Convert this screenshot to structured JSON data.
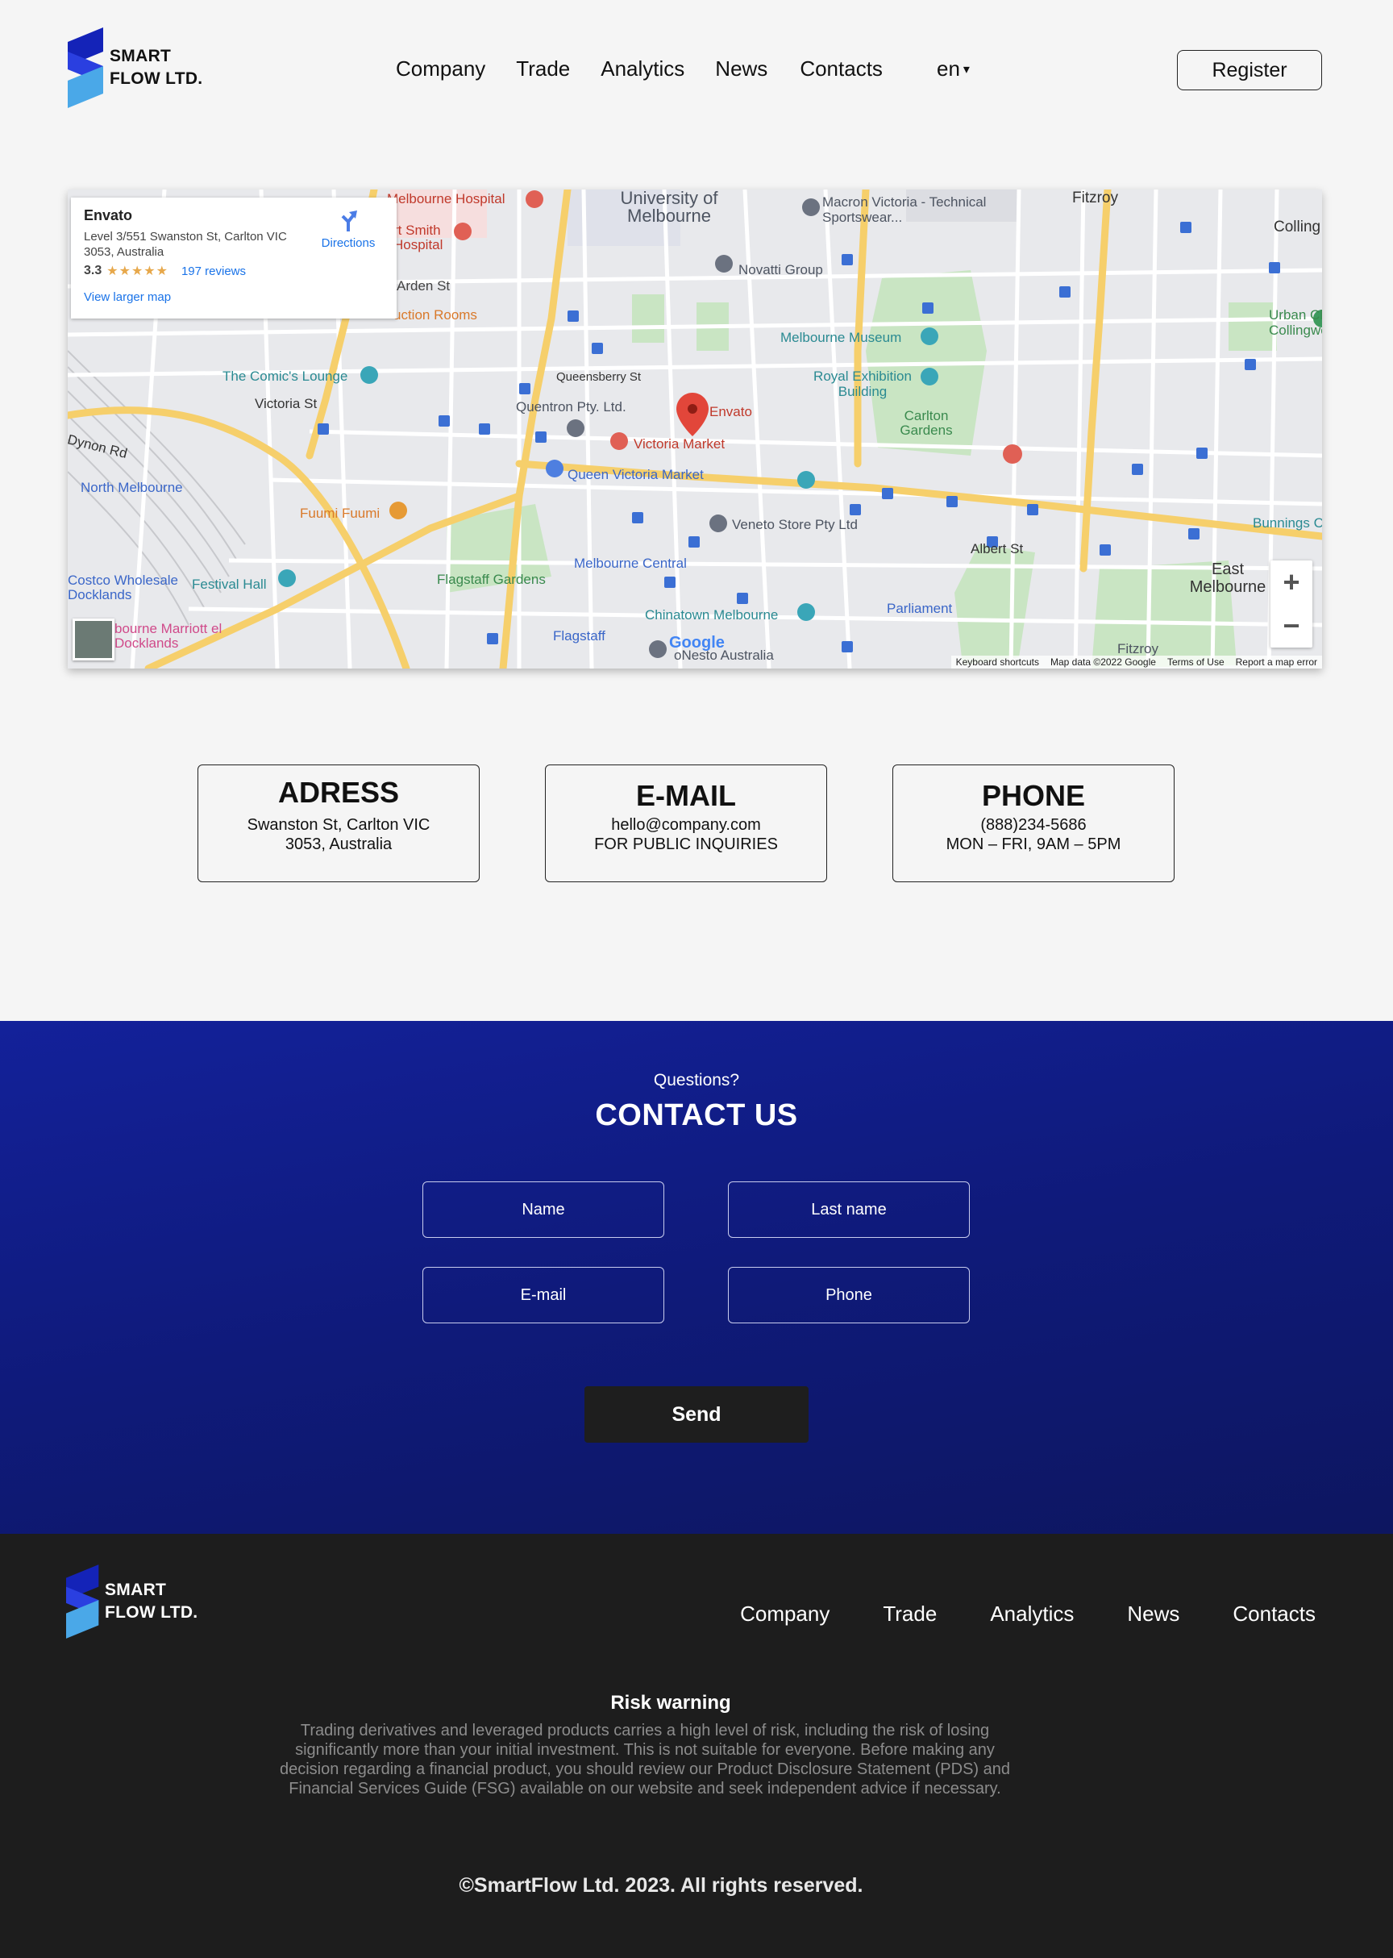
{
  "brand": {
    "line1": "SMART",
    "line2": "FLOW LTD.",
    "colors": {
      "dark": "#1423b8",
      "mid": "#2a3fe0",
      "light": "#4aa8e8"
    }
  },
  "nav": {
    "items": [
      "Company",
      "Trade",
      "Analytics",
      "News",
      "Contacts"
    ]
  },
  "lang": {
    "value": "en",
    "caret": "▾"
  },
  "header": {
    "register_label": "Register"
  },
  "map": {
    "card": {
      "title": "Envato",
      "address": "Level 3/551 Swanston St, Carlton VIC 3053, Australia",
      "rating": "3.3",
      "stars": "★★★★★",
      "reviews": "197 reviews",
      "larger_map": "View larger map",
      "directions": "Directions"
    },
    "labels": {
      "university": "University of Melbourne",
      "melbourne_hospital": "Melbourne Hospital",
      "art_smith": "rt Smith Hospital",
      "macron": "Macron Victoria - Technical Sportswear...",
      "fitzroy": "Fitzroy",
      "collingwood": "Colling",
      "arden": "Arden St",
      "auction": "uction Rooms",
      "novatti": "Novatti Group",
      "museum": "Melbourne Museum",
      "exhibition": "Royal Exhibition Building",
      "carlton_gardens": "Carlton Gardens",
      "comics": "The Comic's Lounge",
      "victoria_st": "Victoria St",
      "quentron": "Quentron Pty. Ltd.",
      "envato_pin": "Envato",
      "victoria_market": "Victoria Market",
      "queen_vic": "Queen Victoria Market",
      "queensberry": "Queensberry St",
      "north_melbourne": "North Melbourne",
      "fuumi": "Fuumi Fuumi",
      "veneto": "Veneto Store Pty Ltd",
      "melbourne_central": "Melbourne Central",
      "flagstaff_gardens": "Flagstaff Gardens",
      "festival_hall": "Festival Hall",
      "costco": "Costco Wholesale Docklands",
      "marriott": "bourne Marriott el Docklands",
      "chinatown": "Chinatown Melbourne",
      "flagstaff": "Flagstaff",
      "nesto": "oNesto Australia",
      "parliament": "Parliament",
      "albert": "Albert St",
      "east_melbourne": "East Melbourne",
      "bunnings": "Bunnings Colli",
      "urban_climb": "Urban Climb Collingwood",
      "fitzroy_bottom": "Fitzroy",
      "dynon": "Dynon Rd",
      "google": "Google"
    },
    "zoom_in": "+",
    "zoom_out": "−",
    "footer": [
      "Keyboard shortcuts",
      "Map data ©2022 Google",
      "Terms of Use",
      "Report a map error"
    ]
  },
  "info": {
    "address": {
      "title": "ADRESS",
      "line1": "Swanston St, Carlton VIC",
      "line2": "3053, Australia"
    },
    "email": {
      "title": "E-MAIL",
      "line1": "hello@company.com",
      "line2": "FOR PUBLIC INQUIRIES"
    },
    "phone": {
      "title": "PHONE",
      "line1": "(888)234-5686",
      "line2": "MON – FRI, 9AM – 5PM"
    }
  },
  "contact": {
    "question": "Questions?",
    "title": "CONTACT US",
    "fields": {
      "name": "Name",
      "last_name": "Last name",
      "email": "E-mail",
      "phone": "Phone"
    },
    "send_label": "Send"
  },
  "footer": {
    "risk_title": "Risk warning",
    "risk_text": "Trading derivatives and leveraged products carries a high level of risk, including the risk of losing significantly more than your initial investment. This is not suitable for everyone. Before making any decision regarding a financial product, you should review our Product Disclosure Statement (PDS) and Financial Services Guide (FSG) available on our website and seek independent advice if necessary.",
    "copyright": "©SmartFlow Ltd. 2023. All rights reserved."
  }
}
